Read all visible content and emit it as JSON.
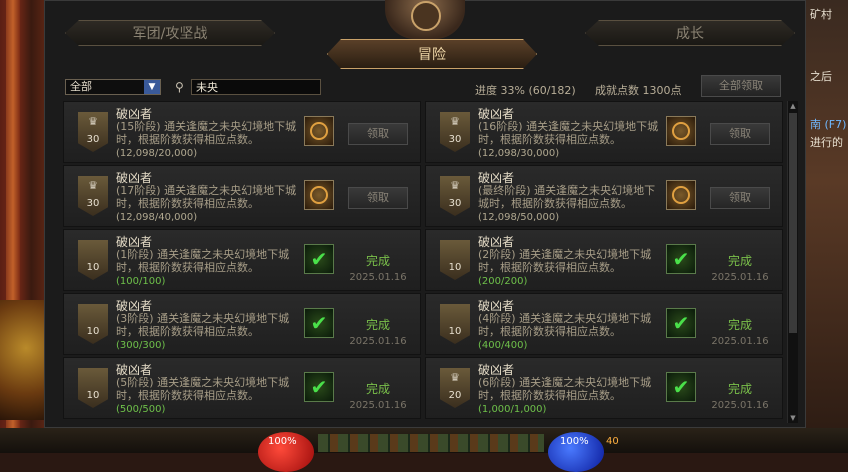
{
  "background": {
    "right_tags": [
      "矿村",
      "之后",
      "南 (F7)",
      "进行的"
    ]
  },
  "hud": {
    "hp": "100%",
    "mp": "100%",
    "level": "40"
  },
  "window": {
    "tabs": {
      "guild": "军团/攻坚战",
      "adventure": "冒险",
      "growth": "成长"
    },
    "filter": {
      "selected": "全部"
    },
    "search": {
      "value": "未央"
    },
    "progress_text": "进度  33%  (60/182)",
    "points_text": "成就点数 1300点",
    "claim_all_label": "全部领取",
    "cards": [
      {
        "title": "破凶者",
        "badge": "30",
        "trophy": true,
        "desc": "(15阶段) 通关逢魔之未央幻境地下城时，根据阶数获得相应点数。",
        "progress": "(12,098/20,000)",
        "done": false,
        "button": "领取"
      },
      {
        "title": "破凶者",
        "badge": "30",
        "trophy": true,
        "desc": "(16阶段) 通关逢魔之未央幻境地下城时，根据阶数获得相应点数。",
        "progress": "(12,098/30,000)",
        "done": false,
        "button": "领取"
      },
      {
        "title": "破凶者",
        "badge": "30",
        "trophy": true,
        "desc": "(17阶段) 通关逢魔之未央幻境地下城时，根据阶数获得相应点数。",
        "progress": "(12,098/40,000)",
        "done": false,
        "button": "领取"
      },
      {
        "title": "破凶者",
        "badge": "30",
        "trophy": true,
        "desc": "(最终阶段) 通关逢魔之未央幻境地下城时，根据阶数获得相应点数。",
        "progress": "(12,098/50,000)",
        "done": false,
        "button": "领取"
      },
      {
        "title": "破凶者",
        "badge": "10",
        "trophy": false,
        "desc": "(1阶段) 通关逢魔之未央幻境地下城时，根据阶数获得相应点数。",
        "progress": "(100/100)",
        "done": true,
        "status": "完成",
        "date": "2025.01.16"
      },
      {
        "title": "破凶者",
        "badge": "10",
        "trophy": false,
        "desc": "(2阶段) 通关逢魔之未央幻境地下城时，根据阶数获得相应点数。",
        "progress": "(200/200)",
        "done": true,
        "status": "完成",
        "date": "2025.01.16"
      },
      {
        "title": "破凶者",
        "badge": "10",
        "trophy": false,
        "desc": "(3阶段) 通关逢魔之未央幻境地下城时，根据阶数获得相应点数。",
        "progress": "(300/300)",
        "done": true,
        "status": "完成",
        "date": "2025.01.16"
      },
      {
        "title": "破凶者",
        "badge": "10",
        "trophy": false,
        "desc": "(4阶段) 通关逢魔之未央幻境地下城时，根据阶数获得相应点数。",
        "progress": "(400/400)",
        "done": true,
        "status": "完成",
        "date": "2025.01.16"
      },
      {
        "title": "破凶者",
        "badge": "10",
        "trophy": false,
        "desc": "(5阶段) 通关逢魔之未央幻境地下城时，根据阶数获得相应点数。",
        "progress": "(500/500)",
        "done": true,
        "status": "完成",
        "date": "2025.01.16"
      },
      {
        "title": "破凶者",
        "badge": "20",
        "trophy": true,
        "desc": "(6阶段) 通关逢魔之未央幻境地下城时，根据阶数获得相应点数。",
        "progress": "(1,000/1,000)",
        "done": true,
        "status": "完成",
        "date": "2025.01.16"
      }
    ]
  },
  "icons": {
    "search": "search-icon",
    "dropdown": "chevron-down-icon",
    "trophy": "trophy-icon",
    "reward": "emblem-icon",
    "check": "check-icon"
  }
}
